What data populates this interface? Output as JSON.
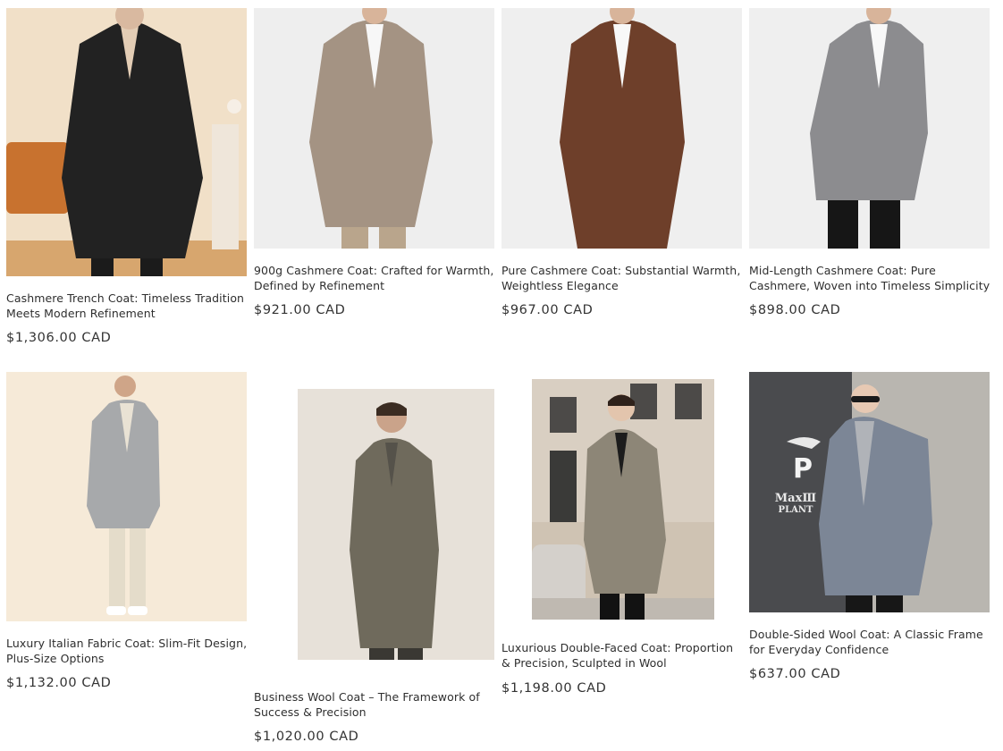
{
  "products": [
    {
      "title": "Cashmere Trench Coat: Timeless Tradition Meets Modern Refinement",
      "price": "$1,306.00 CAD",
      "image_alt": "black-cashmere-trench-coat",
      "coat_color": "#222222"
    },
    {
      "title": "900g Cashmere Coat: Crafted for Warmth, Defined by Refinement",
      "price": "$921.00 CAD",
      "image_alt": "taupe-cashmere-coat",
      "coat_color": "#a49383"
    },
    {
      "title": "Pure Cashmere Coat: Substantial Warmth, Weightless Elegance",
      "price": "$967.00 CAD",
      "image_alt": "brown-cashmere-coat",
      "coat_color": "#6e3f2a"
    },
    {
      "title": "Mid-Length Cashmere Coat: Pure Cashmere, Woven into Timeless Simplicity",
      "price": "$898.00 CAD",
      "image_alt": "grey-cashmere-coat",
      "coat_color": "#8c8c8f"
    },
    {
      "title": "Luxury Italian Fabric Coat: Slim-Fit Design, Plus-Size Options",
      "price": "$1,132.00 CAD",
      "image_alt": "light-grey-slim-coat",
      "coat_color": "#a7a9ab"
    },
    {
      "title": "Business Wool Coat – The Framework of Success & Precision",
      "price": "$1,020.00 CAD",
      "image_alt": "olive-wool-coat",
      "coat_color": "#6f6a5c"
    },
    {
      "title": "Luxurious Double-Faced Coat: Proportion & Precision, Sculpted in Wool",
      "price": "$1,198.00 CAD",
      "image_alt": "khaki-double-faced-coat",
      "coat_color": "#8d8677"
    },
    {
      "title": "Double-Sided Wool Coat: A Classic Frame for Everyday Confidence",
      "price": "$637.00 CAD",
      "image_alt": "blue-grey-wool-coat",
      "coat_color": "#7c8696"
    }
  ],
  "sign_text": {
    "letter": "P",
    "line1": "MaxⅢ",
    "line2": "PLANT"
  }
}
